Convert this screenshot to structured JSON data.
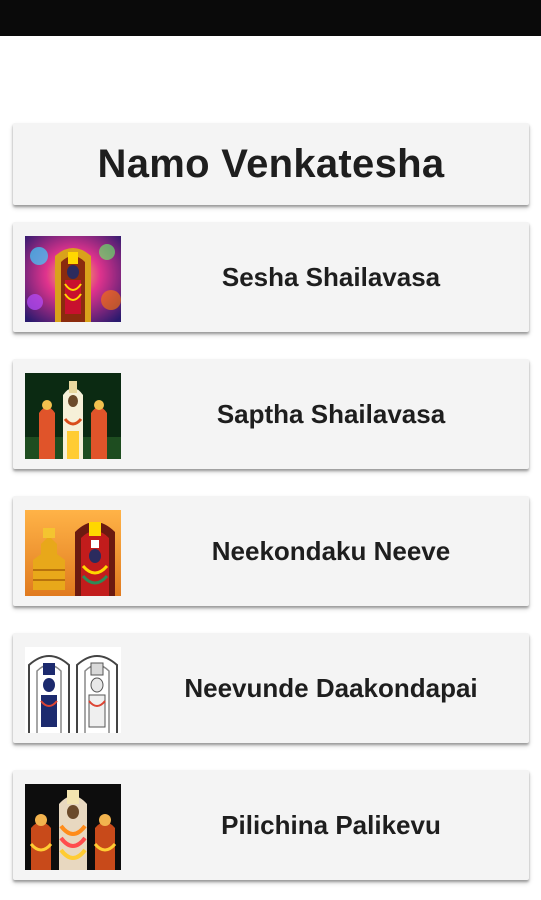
{
  "header": {
    "title": "Namo Venkatesha"
  },
  "songs": [
    {
      "label": "Sesha Shailavasa",
      "thumb_icon": "deity-on-colorful-background"
    },
    {
      "label": "Saptha Shailavasa",
      "thumb_icon": "deity-with-consorts"
    },
    {
      "label": "Neekondaku Neeve",
      "thumb_icon": "temple-and-deity"
    },
    {
      "label": "Neevunde Daakondapai",
      "thumb_icon": "deity-line-drawing"
    },
    {
      "label": "Pilichina Palikevu",
      "thumb_icon": "deity-with-garlands"
    }
  ],
  "colors": {
    "status_bar": "#0a0a0a",
    "card_background": "#f4f4f4",
    "text": "#1e1e1e"
  }
}
